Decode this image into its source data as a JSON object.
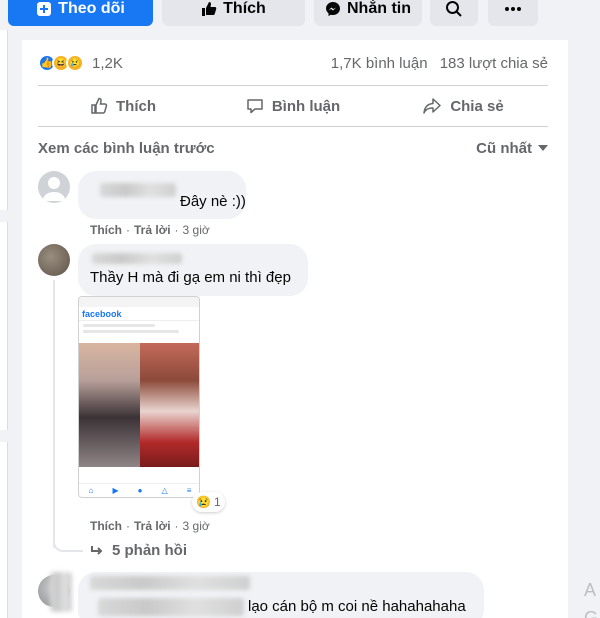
{
  "header": {
    "follow_label": "Theo dõi",
    "like_label": "Thích",
    "message_label": "Nhắn tin"
  },
  "post": {
    "reaction_count": "1,2K",
    "comment_count": "1,7K bình luận",
    "share_count": "183 lượt chia sẻ",
    "actions": {
      "like": "Thích",
      "comment": "Bình luận",
      "share": "Chia sẻ"
    }
  },
  "comments_section": {
    "view_previous": "Xem các bình luận trước",
    "sort_label": "Cũ nhất",
    "comments": [
      {
        "text": "Đây nè :))",
        "like": "Thích",
        "reply": "Trả lời",
        "time": "3 giờ"
      },
      {
        "text": "Thầy H mà đi gạ em ni thì đẹp",
        "like": "Thích",
        "reply": "Trả lời",
        "time": "3 giờ",
        "attachment_app_name": "facebook",
        "attachment_reaction_count": "1",
        "replies_label": "5 phản hồi"
      },
      {
        "text": "lạo cán bộ m coi nề hahahahaha"
      }
    ]
  },
  "colors": {
    "brand": "#1877f2",
    "muted_text": "#65676b",
    "bubble": "#f0f2f5"
  }
}
